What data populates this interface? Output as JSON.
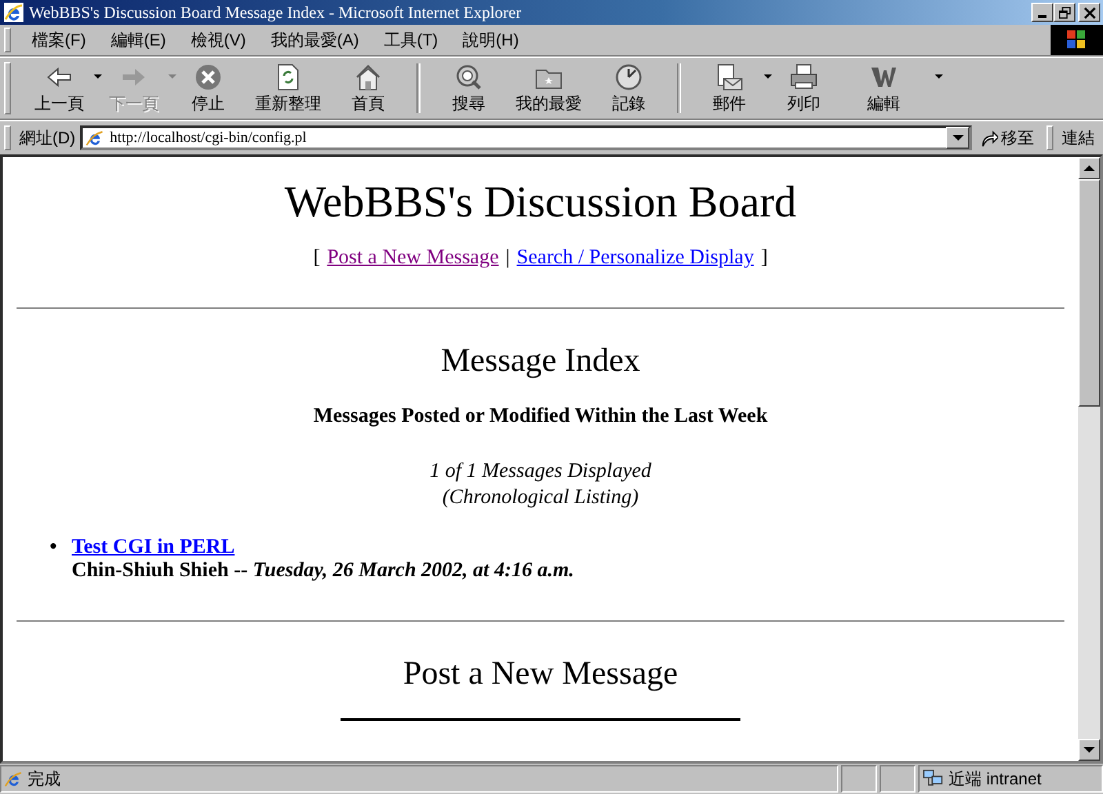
{
  "window": {
    "title": "WebBBS's Discussion Board Message Index - Microsoft Internet Explorer"
  },
  "menu": [
    "檔案(F)",
    "編輯(E)",
    "檢視(V)",
    "我的最愛(A)",
    "工具(T)",
    "說明(H)"
  ],
  "toolbar": [
    [
      {
        "label": "上一頁",
        "disabled": false,
        "dropdown": true
      },
      {
        "label": "下一頁",
        "disabled": true,
        "dropdown": true
      },
      {
        "label": "停止",
        "disabled": false,
        "dropdown": false
      },
      {
        "label": "重新整理",
        "disabled": false,
        "dropdown": false
      },
      {
        "label": "首頁",
        "disabled": false,
        "dropdown": false
      }
    ],
    [
      {
        "label": "搜尋",
        "disabled": false,
        "dropdown": false
      },
      {
        "label": "我的最愛",
        "disabled": false,
        "dropdown": false
      },
      {
        "label": "記錄",
        "disabled": false,
        "dropdown": false
      }
    ],
    [
      {
        "label": "郵件",
        "disabled": false,
        "dropdown": true
      },
      {
        "label": "列印",
        "disabled": false,
        "dropdown": false
      },
      {
        "label": "編輯",
        "disabled": false,
        "dropdown": true
      }
    ]
  ],
  "address": {
    "label": "網址(D)",
    "value": "http://localhost/cgi-bin/config.pl",
    "go": "移至",
    "links": "連結"
  },
  "page": {
    "title": "WebBBS's Discussion Board",
    "nav": [
      {
        "label": "Post a New Message",
        "visited": true
      },
      {
        "label": "Search / Personalize Display",
        "visited": false
      }
    ],
    "nav_open": "[",
    "nav_sep": "|",
    "nav_close": "]",
    "index_heading": "Message Index",
    "subheading": "Messages Posted or Modified Within the Last Week",
    "count": "1 of 1 Messages Displayed",
    "order": "(Chronological Listing)",
    "messages": [
      {
        "bullet": "•",
        "subject": "Test CGI in PERL",
        "author": "Chin-Shiuh Shieh",
        "separator": "--",
        "date": "Tuesday, 26 March 2002, at 4:16 a.m."
      }
    ],
    "post_heading": "Post a New Message"
  },
  "status_bar": {
    "text": "完成",
    "zone": "近端 intranet"
  }
}
